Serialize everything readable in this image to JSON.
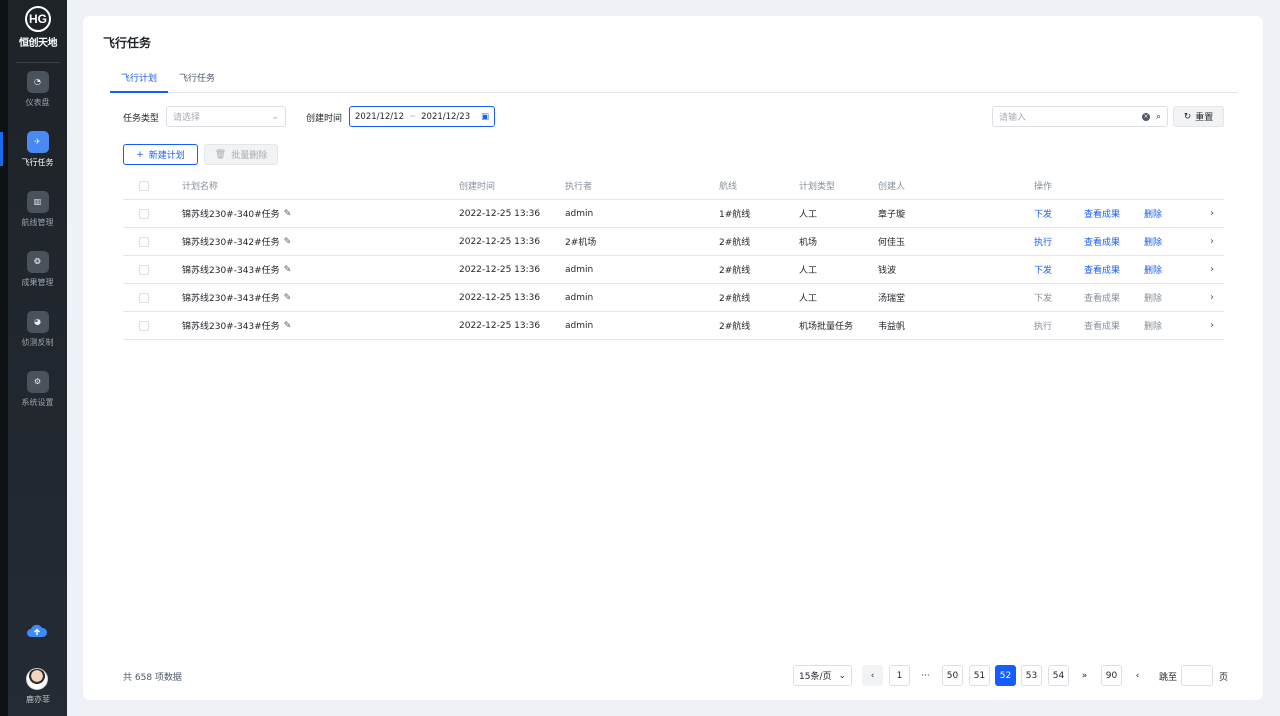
{
  "brand": {
    "logo_mark": "HG",
    "name": "恒创天地"
  },
  "sidebar": {
    "items": [
      {
        "label": "仪表盘",
        "icon": "dashboard-icon",
        "glyph": "◔"
      },
      {
        "label": "飞行任务",
        "icon": "plane-icon",
        "glyph": "✈"
      },
      {
        "label": "航线管理",
        "icon": "map-icon",
        "glyph": "▥"
      },
      {
        "label": "成果管理",
        "icon": "results-icon",
        "glyph": "❂"
      },
      {
        "label": "侦测反制",
        "icon": "radar-icon",
        "glyph": "◕"
      },
      {
        "label": "系统设置",
        "icon": "gear-icon",
        "glyph": "⚙"
      }
    ],
    "active_index": 1,
    "user_name": "鹿亦菲"
  },
  "page": {
    "title": "飞行任务"
  },
  "tabs": [
    {
      "label": "飞行计划"
    },
    {
      "label": "飞行任务"
    }
  ],
  "filters": {
    "task_type_label": "任务类型",
    "task_type_placeholder": "请选择",
    "created_label": "创建时间",
    "date_start": "2021/12/12",
    "date_sep": "~",
    "date_end": "2021/12/23",
    "search_placeholder": "请输入",
    "reset_label": "重置"
  },
  "actions": {
    "new_label": "新建计划",
    "batch_delete_label": "批量删除"
  },
  "table": {
    "headers": {
      "name": "计划名称",
      "created": "创建时间",
      "executor": "执行者",
      "route": "航线",
      "type": "计划类型",
      "creator": "创建人",
      "ops": "操作"
    },
    "rows": [
      {
        "name": "锦苏线230#-340#任务",
        "created": "2022-12-25 13:36",
        "executor": "admin",
        "route": "1#航线",
        "type": "人工",
        "creator": "章子璇",
        "op1": "下发",
        "op2": "查看成果",
        "op3": "删除",
        "enabled": true
      },
      {
        "name": "锦苏线230#-342#任务",
        "created": "2022-12-25 13:36",
        "executor": "2#机场",
        "route": "2#航线",
        "type": "机场",
        "creator": "何佳玉",
        "op1": "执行",
        "op2": "查看成果",
        "op3": "删除",
        "enabled": true
      },
      {
        "name": "锦苏线230#-343#任务",
        "created": "2022-12-25 13:36",
        "executor": "admin",
        "route": "2#航线",
        "type": "人工",
        "creator": "钱波",
        "op1": "下发",
        "op2": "查看成果",
        "op3": "删除",
        "enabled": true
      },
      {
        "name": "锦苏线230#-343#任务",
        "created": "2022-12-25 13:36",
        "executor": "admin",
        "route": "2#航线",
        "type": "人工",
        "creator": "汤瑞堂",
        "op1": "下发",
        "op2": "查看成果",
        "op3": "删除",
        "enabled": false
      },
      {
        "name": "锦苏线230#-343#任务",
        "created": "2022-12-25 13:36",
        "executor": "admin",
        "route": "2#航线",
        "type": "机场批量任务",
        "creator": "韦益帆",
        "op1": "执行",
        "op2": "查看成果",
        "op3": "删除",
        "enabled": false
      }
    ]
  },
  "pagination": {
    "total_text": "共 658 项数据",
    "page_size": "15条/页",
    "prev": "‹",
    "first": "1",
    "ellipsis": "···",
    "pages": [
      "50",
      "51",
      "52",
      "53",
      "54"
    ],
    "current": "52",
    "jump_more": "»",
    "last": "90",
    "next": "‹",
    "jump_label": "跳至",
    "page_unit": "页"
  },
  "colors": {
    "primary": "#165dff",
    "sidebar_bg": "#1e2328",
    "active_nav": "#4a88f2"
  }
}
